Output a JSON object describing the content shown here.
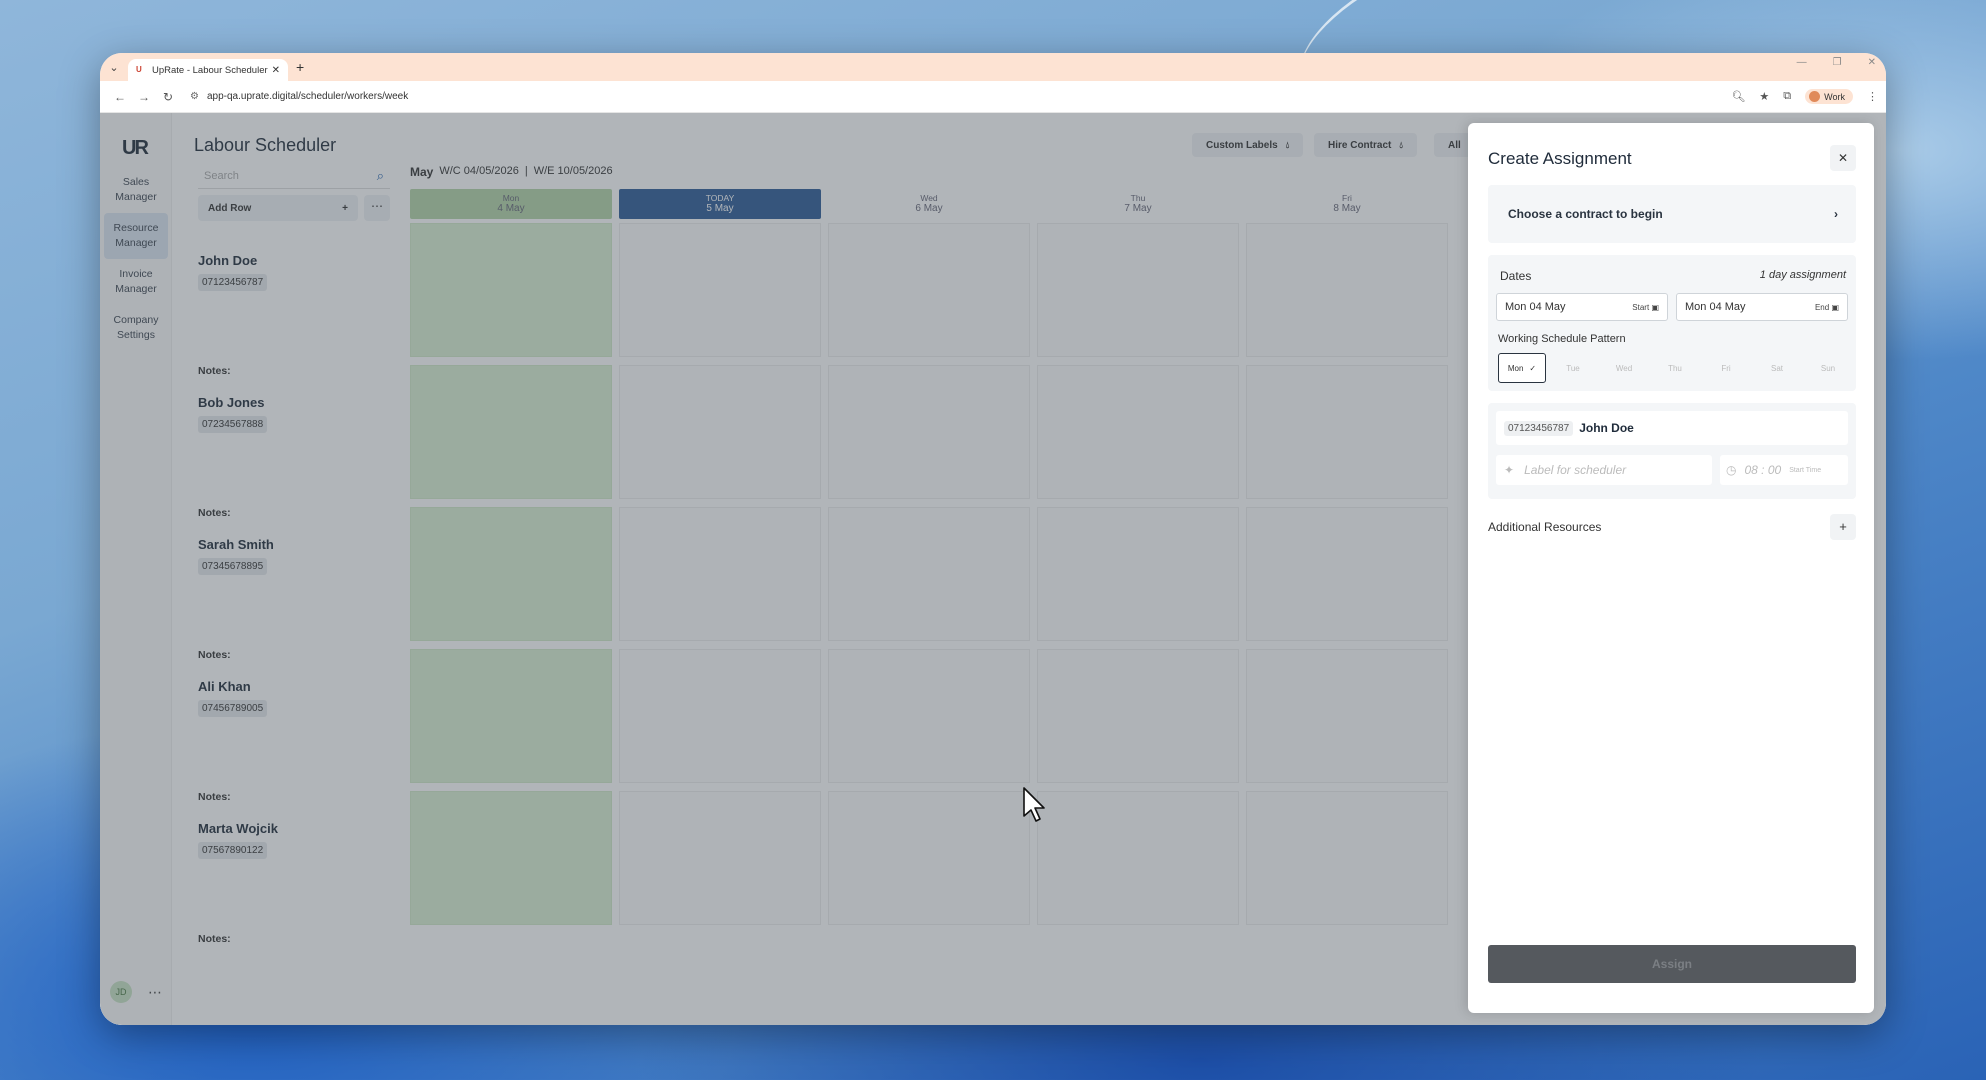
{
  "browser": {
    "tab_title": "UpRate - Labour Scheduler",
    "url": "app-qa.uprate.digital/scheduler/workers/week",
    "profile_label": "Work"
  },
  "sidebar": {
    "logo": "UR",
    "items": [
      {
        "label": "Sales Manager"
      },
      {
        "label": "Resource Manager",
        "active": true
      },
      {
        "label": "Invoice Manager"
      },
      {
        "label": "Company Settings"
      }
    ],
    "avatar_initials": "JD"
  },
  "header": {
    "title": "Labour Scheduler",
    "buttons": [
      {
        "label": "Custom Labels"
      },
      {
        "label": "Hire Contract"
      },
      {
        "label": "All"
      }
    ]
  },
  "controls": {
    "search_placeholder": "Search",
    "add_row_label": "Add Row"
  },
  "week": {
    "month": "May",
    "wc": "W/C 04/05/2026",
    "sep": "|",
    "we": "W/E 10/05/2026",
    "days": [
      {
        "name": "Mon",
        "date": "4 May"
      },
      {
        "name": "TODAY",
        "date": "5 May"
      },
      {
        "name": "Wed",
        "date": "6 May"
      },
      {
        "name": "Thu",
        "date": "7 May"
      },
      {
        "name": "Fri",
        "date": "8 May"
      }
    ]
  },
  "workers": [
    {
      "name": "John Doe",
      "phone": "07123456787",
      "notes": "Notes:"
    },
    {
      "name": "Bob Jones",
      "phone": "07234567888",
      "notes": "Notes:"
    },
    {
      "name": "Sarah Smith",
      "phone": "07345678895",
      "notes": "Notes:"
    },
    {
      "name": "Ali Khan",
      "phone": "07456789005",
      "notes": "Notes:"
    },
    {
      "name": "Marta Wojcik",
      "phone": "07567890122",
      "notes": "Notes:"
    }
  ],
  "panel": {
    "title": "Create Assignment",
    "contract_prompt": "Choose a contract to begin",
    "dates_label": "Dates",
    "duration": "1 day assignment",
    "start_date": "Mon 04 May",
    "start_tag": "Start",
    "end_date": "Mon 04 May",
    "end_tag": "End",
    "pattern_label": "Working Schedule Pattern",
    "pattern_days": [
      "Mon",
      "Tue",
      "Wed",
      "Thu",
      "Fri",
      "Sat",
      "Sun"
    ],
    "selected_day": "Mon",
    "worker_phone": "07123456787",
    "worker_name": "John Doe",
    "label_placeholder": "Label for scheduler",
    "time_placeholder": "08 : 00",
    "time_tag": "Start Time",
    "additional_resources": "Additional Resources",
    "assign_label": "Assign"
  }
}
